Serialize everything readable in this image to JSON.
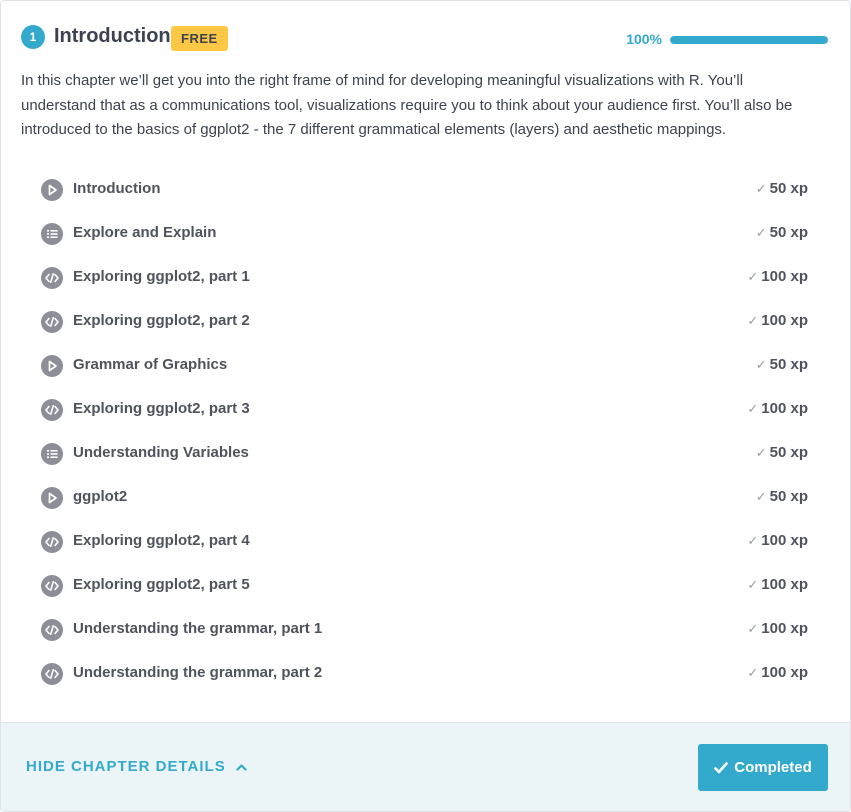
{
  "chapter": {
    "number": "1",
    "title": "Introduction",
    "badge": "FREE",
    "progress_label": "100%",
    "progress_fraction": 1.0,
    "description": "In this chapter we’ll get you into the right frame of mind for developing meaningful visualizations with R. You’ll understand that as a communications tool, visualizations require you to think about your audience first. You’ll also be introduced to the basics of ggplot2 - the 7 different grammatical elements (layers) and aesthetic mappings."
  },
  "exercises": [
    {
      "icon": "play-icon",
      "title": "Introduction",
      "xp": "50 xp"
    },
    {
      "icon": "list-icon",
      "title": "Explore and Explain",
      "xp": "50 xp"
    },
    {
      "icon": "code-icon",
      "title": "Exploring ggplot2, part 1",
      "xp": "100 xp"
    },
    {
      "icon": "code-icon",
      "title": "Exploring ggplot2, part 2",
      "xp": "100 xp"
    },
    {
      "icon": "play-icon",
      "title": "Grammar of Graphics",
      "xp": "50 xp"
    },
    {
      "icon": "code-icon",
      "title": "Exploring ggplot2, part 3",
      "xp": "100 xp"
    },
    {
      "icon": "list-icon",
      "title": "Understanding Variables",
      "xp": "50 xp"
    },
    {
      "icon": "play-icon",
      "title": "ggplot2",
      "xp": "50 xp"
    },
    {
      "icon": "code-icon",
      "title": "Exploring ggplot2, part 4",
      "xp": "100 xp"
    },
    {
      "icon": "code-icon",
      "title": "Exploring ggplot2, part 5",
      "xp": "100 xp"
    },
    {
      "icon": "code-icon",
      "title": "Understanding the grammar, part 1",
      "xp": "100 xp"
    },
    {
      "icon": "code-icon",
      "title": "Understanding the grammar, part 2",
      "xp": "100 xp"
    }
  ],
  "footer": {
    "hide_details_label": "HIDE CHAPTER DETAILS",
    "completed_label": "Completed"
  },
  "colors": {
    "accent": "#33aacc",
    "badge": "#ffc844",
    "icon_gray": "#8c8f98",
    "footer_bg": "#ebf4f7"
  }
}
